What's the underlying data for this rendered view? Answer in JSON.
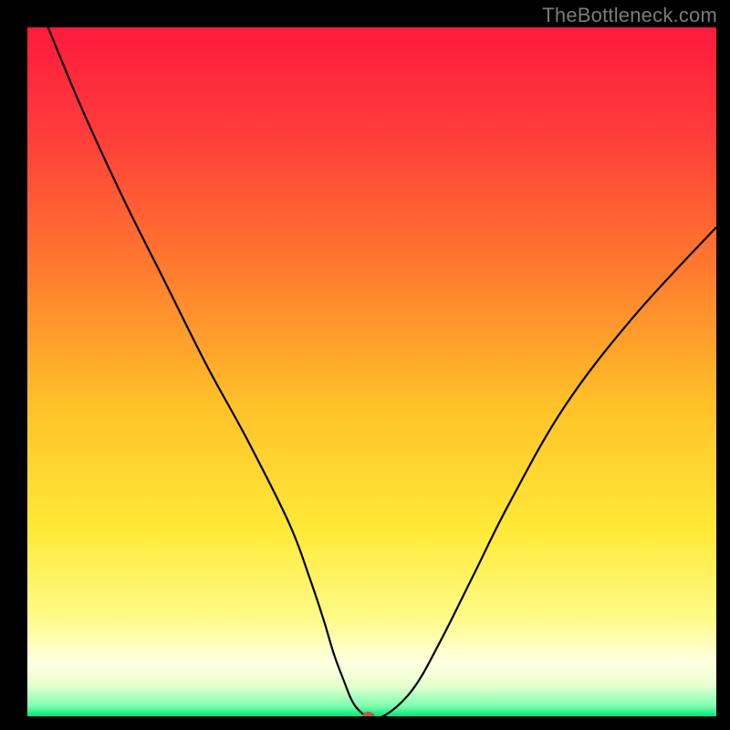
{
  "watermark": "TheBottleneck.com",
  "chart_data": {
    "type": "line",
    "title": "",
    "xlabel": "",
    "ylabel": "",
    "xlim": [
      0,
      100
    ],
    "ylim": [
      0,
      100
    ],
    "grid": false,
    "legend": false,
    "series": [
      {
        "name": "bottleneck-curve",
        "x": [
          3,
          8,
          14,
          20,
          26,
          32,
          38,
          41,
          43,
          44.5,
          46,
          47,
          48,
          49.5,
          52,
          56,
          60,
          65,
          70,
          78,
          88,
          100
        ],
        "y": [
          100,
          88,
          75,
          63,
          51,
          40,
          28,
          20,
          14,
          9,
          5,
          2.5,
          1,
          0,
          0.2,
          4,
          11,
          21,
          31,
          45,
          58,
          71
        ]
      }
    ],
    "marker": {
      "x": 49.5,
      "y": 0,
      "color": "#b85c4a"
    },
    "gradient_stops": [
      {
        "offset": 0.0,
        "color": "#ff1a3d"
      },
      {
        "offset": 0.15,
        "color": "#ff3b3b"
      },
      {
        "offset": 0.35,
        "color": "#ff7a2e"
      },
      {
        "offset": 0.55,
        "color": "#ffc229"
      },
      {
        "offset": 0.73,
        "color": "#ffe937"
      },
      {
        "offset": 0.86,
        "color": "#fffb8a"
      },
      {
        "offset": 0.92,
        "color": "#ffffe0"
      },
      {
        "offset": 0.955,
        "color": "#e8ffd0"
      },
      {
        "offset": 0.985,
        "color": "#7dffb0"
      },
      {
        "offset": 1.0,
        "color": "#00e57a"
      }
    ]
  }
}
